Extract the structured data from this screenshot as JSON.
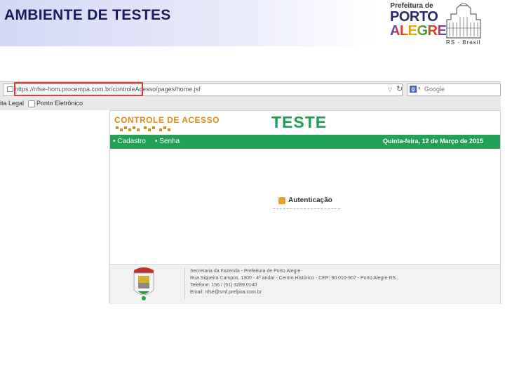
{
  "slide": {
    "title": "AMBIENTE DE TESTES"
  },
  "logo": {
    "line1": "Prefeitura de",
    "line2": "PORTO",
    "line3": "ALEGRE",
    "rs": "RS - Brasil"
  },
  "browser": {
    "url": "https://nfse-hom.procempa.com.br/controleAcesso/pages/home.jsf",
    "search_placeholder": "Google",
    "bookmarks": [
      "ita Legal",
      "Ponto Eletrônico"
    ]
  },
  "site": {
    "header_title": "CONTROLE DE ACESSO",
    "badge": "TESTE",
    "nav": [
      "• Cadastro",
      "• Senha"
    ],
    "date": "Quinta-feira, 12 de Março de 2015",
    "auth_link": "Autenticação",
    "footer_lines": [
      "Secretaria da Fazenda - Prefeitura de Porto Alegre",
      "Rua Siqueira Campos, 1300 - 4º andar - Centro Histórico - CEP: 90.010-907 - Porto Alegre RS.",
      "Telefone: 156 / (51) 3289.0140",
      "Email: nfse@smf.prefpoa.com.br"
    ]
  },
  "colors": {
    "green": "#22a055",
    "orange": "#e08a1a",
    "highlight": "#e23a3a"
  }
}
